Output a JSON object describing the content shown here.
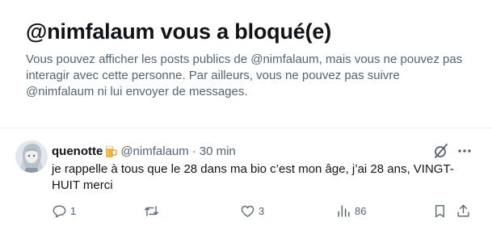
{
  "blocked": {
    "title": "@nimfalaum vous a bloqué(e)",
    "description": "Vous pouvez afficher les posts publics de @nimfalaum, mais vous ne pouvez pas interagir avec cette personne. Par ailleurs, vous ne pouvez pas suivre @nimfalaum ni lui envoyer de messages."
  },
  "tweet": {
    "display_name": "quenotte",
    "name_emoji": "beer-mug-icon",
    "handle": "@nimfalaum",
    "separator": "·",
    "time": "30 min",
    "text": "je rappelle à tous que le 28 dans ma bio c’est mon âge, j’ai 28 ans, VINGT-HUIT merci",
    "actions": {
      "replies": "1",
      "retweets": "",
      "likes": "3",
      "views": "86"
    }
  },
  "icons": {
    "avatar": "avatar",
    "grok": "grok-icon",
    "more": "more-icon",
    "reply": "reply-icon",
    "retweet": "retweet-icon",
    "like": "heart-icon",
    "views": "views-icon",
    "bookmark": "bookmark-icon",
    "share": "share-icon"
  },
  "colors": {
    "text": "#0f1419",
    "secondary": "#536471",
    "divider": "#eff3f4",
    "background": "#ffffff"
  }
}
